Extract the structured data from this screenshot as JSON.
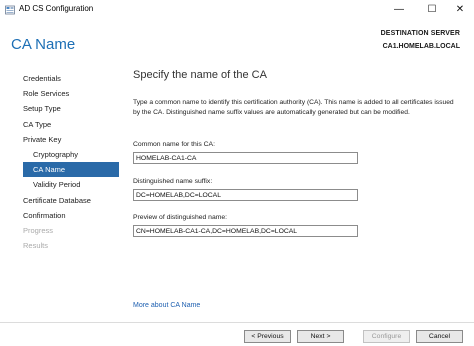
{
  "window": {
    "title": "AD CS Configuration",
    "minimize": "—",
    "maximize": "☐",
    "close": "✕"
  },
  "header": {
    "title": "CA Name",
    "destination_label": "DESTINATION SERVER",
    "destination_value": "CA1.HOMELAB.LOCAL"
  },
  "nav": {
    "items": [
      {
        "label": "Credentials"
      },
      {
        "label": "Role Services"
      },
      {
        "label": "Setup Type"
      },
      {
        "label": "CA Type"
      },
      {
        "label": "Private Key"
      },
      {
        "label": "Cryptography"
      },
      {
        "label": "CA Name"
      },
      {
        "label": "Validity Period"
      },
      {
        "label": "Certificate Database"
      },
      {
        "label": "Confirmation"
      },
      {
        "label": "Progress"
      },
      {
        "label": "Results"
      }
    ]
  },
  "main": {
    "heading": "Specify the name of the CA",
    "description": "Type a common name to identify this certification authority (CA). This name is added to all certificates issued by the CA. Distinguished name suffix values are automatically generated but can be modified.",
    "common_name_label": "Common name for this CA:",
    "common_name_value": "HOMELAB-CA1-CA",
    "dn_suffix_label": "Distinguished name suffix:",
    "dn_suffix_value": "DC=HOMELAB,DC=LOCAL",
    "preview_label": "Preview of distinguished name:",
    "preview_value": "CN=HOMELAB-CA1-CA,DC=HOMELAB,DC=LOCAL",
    "more_link": "More about CA Name"
  },
  "footer": {
    "previous": "< Previous",
    "next": "Next >",
    "configure": "Configure",
    "cancel": "Cancel"
  }
}
